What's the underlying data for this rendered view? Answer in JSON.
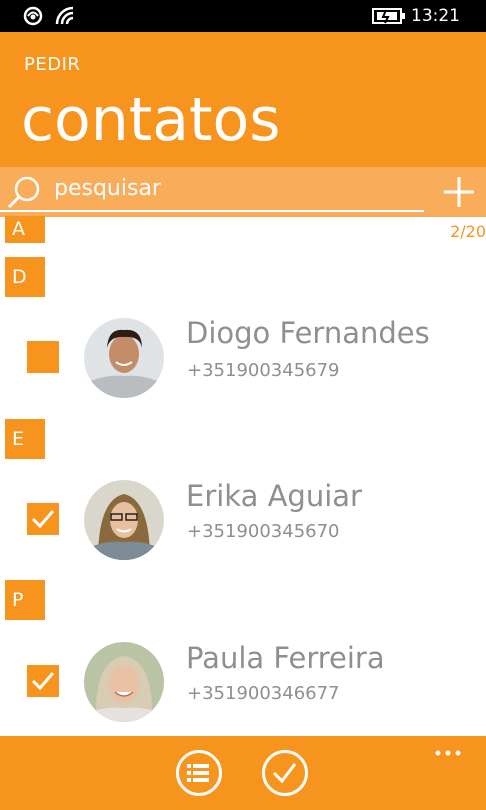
{
  "statusbar": {
    "time": "13:21",
    "icons": [
      "nfc-icon",
      "wifi-icon",
      "battery-charging-icon"
    ]
  },
  "header": {
    "subtitle": "PEDIR",
    "title": "contatos"
  },
  "search": {
    "placeholder": "pesquisar",
    "value": ""
  },
  "counter": "2/20",
  "groups": [
    "A",
    "D",
    "E",
    "P"
  ],
  "contacts": [
    {
      "name": "Diogo Fernandes",
      "phone": "+351900345679",
      "checked": false
    },
    {
      "name": "Erika Aguiar",
      "phone": "+351900345670",
      "checked": true
    },
    {
      "name": "Paula Ferreira",
      "phone": "+351900346677",
      "checked": true
    }
  ],
  "appbar": {
    "buttons": [
      "list-icon",
      "check-icon"
    ],
    "more": "ellipsis-icon"
  },
  "colors": {
    "accent": "#f7941e",
    "search_bg": "#f9ad5a",
    "text_gray": "#8f8f8f"
  }
}
